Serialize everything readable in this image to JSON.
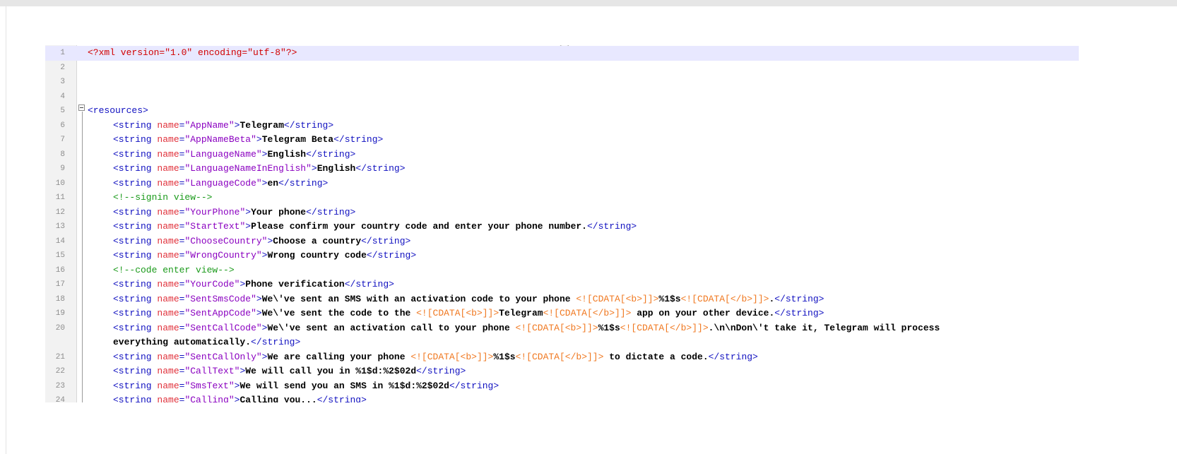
{
  "editor": {
    "lines": [
      {
        "n": "1",
        "segs": [
          [
            "pi",
            "<?xml version=\"1.0\" encoding=\"utf-8\"?>"
          ]
        ]
      },
      {
        "n": "2",
        "segs": []
      },
      {
        "n": "3",
        "segs": []
      },
      {
        "n": "4",
        "segs": []
      },
      {
        "n": "5",
        "segs": [
          [
            "t",
            "<resources>"
          ]
        ]
      },
      {
        "n": "6",
        "segs": [
          [
            "t",
            "<string "
          ],
          [
            "a",
            "name"
          ],
          [
            "t",
            "="
          ],
          [
            "v",
            "\"AppName\""
          ],
          [
            "t",
            ">"
          ],
          [
            "b",
            "Telegram"
          ],
          [
            "t",
            "</string>"
          ]
        ]
      },
      {
        "n": "7",
        "segs": [
          [
            "t",
            "<string "
          ],
          [
            "a",
            "name"
          ],
          [
            "t",
            "="
          ],
          [
            "v",
            "\"AppNameBeta\""
          ],
          [
            "t",
            ">"
          ],
          [
            "b",
            "Telegram Beta"
          ],
          [
            "t",
            "</string>"
          ]
        ]
      },
      {
        "n": "8",
        "segs": [
          [
            "t",
            "<string "
          ],
          [
            "a",
            "name"
          ],
          [
            "t",
            "="
          ],
          [
            "v",
            "\"LanguageName\""
          ],
          [
            "t",
            ">"
          ],
          [
            "b",
            "English"
          ],
          [
            "t",
            "</string>"
          ]
        ]
      },
      {
        "n": "9",
        "segs": [
          [
            "t",
            "<string "
          ],
          [
            "a",
            "name"
          ],
          [
            "t",
            "="
          ],
          [
            "v",
            "\"LanguageNameInEnglish\""
          ],
          [
            "t",
            ">"
          ],
          [
            "b",
            "English"
          ],
          [
            "t",
            "</string>"
          ]
        ]
      },
      {
        "n": "10",
        "segs": [
          [
            "t",
            "<string "
          ],
          [
            "a",
            "name"
          ],
          [
            "t",
            "="
          ],
          [
            "v",
            "\"LanguageCode\""
          ],
          [
            "t",
            ">"
          ],
          [
            "b",
            "en"
          ],
          [
            "t",
            "</string>"
          ]
        ]
      },
      {
        "n": "11",
        "segs": [
          [
            "c",
            "<!--signin view-->"
          ]
        ]
      },
      {
        "n": "12",
        "segs": [
          [
            "t",
            "<string "
          ],
          [
            "a",
            "name"
          ],
          [
            "t",
            "="
          ],
          [
            "v",
            "\"YourPhone\""
          ],
          [
            "t",
            ">"
          ],
          [
            "b",
            "Your phone"
          ],
          [
            "t",
            "</string>"
          ]
        ]
      },
      {
        "n": "13",
        "segs": [
          [
            "t",
            "<string "
          ],
          [
            "a",
            "name"
          ],
          [
            "t",
            "="
          ],
          [
            "v",
            "\"StartText\""
          ],
          [
            "t",
            ">"
          ],
          [
            "b",
            "Please confirm your country code and enter your phone number."
          ],
          [
            "t",
            "</string>"
          ]
        ]
      },
      {
        "n": "14",
        "segs": [
          [
            "t",
            "<string "
          ],
          [
            "a",
            "name"
          ],
          [
            "t",
            "="
          ],
          [
            "v",
            "\"ChooseCountry\""
          ],
          [
            "t",
            ">"
          ],
          [
            "b",
            "Choose a country"
          ],
          [
            "t",
            "</string>"
          ]
        ]
      },
      {
        "n": "15",
        "segs": [
          [
            "t",
            "<string "
          ],
          [
            "a",
            "name"
          ],
          [
            "t",
            "="
          ],
          [
            "v",
            "\"WrongCountry\""
          ],
          [
            "t",
            ">"
          ],
          [
            "b",
            "Wrong country code"
          ],
          [
            "t",
            "</string>"
          ]
        ]
      },
      {
        "n": "16",
        "segs": [
          [
            "c",
            "<!--code enter view-->"
          ]
        ]
      },
      {
        "n": "17",
        "segs": [
          [
            "t",
            "<string "
          ],
          [
            "a",
            "name"
          ],
          [
            "t",
            "="
          ],
          [
            "v",
            "\"YourCode\""
          ],
          [
            "t",
            ">"
          ],
          [
            "b",
            "Phone verification"
          ],
          [
            "t",
            "</string>"
          ]
        ]
      },
      {
        "n": "18",
        "segs": [
          [
            "t",
            "<string "
          ],
          [
            "a",
            "name"
          ],
          [
            "t",
            "="
          ],
          [
            "v",
            "\"SentSmsCode\""
          ],
          [
            "t",
            ">"
          ],
          [
            "b",
            "We\\'ve sent an SMS with an activation code to your phone "
          ],
          [
            "d",
            "<![CDATA[<b>]]>"
          ],
          [
            "b",
            "%1$s"
          ],
          [
            "d",
            "<![CDATA[</b>]]>"
          ],
          [
            "b",
            "."
          ],
          [
            "t",
            "</string>"
          ]
        ]
      },
      {
        "n": "19",
        "segs": [
          [
            "t",
            "<string "
          ],
          [
            "a",
            "name"
          ],
          [
            "t",
            "="
          ],
          [
            "v",
            "\"SentAppCode\""
          ],
          [
            "t",
            ">"
          ],
          [
            "b",
            "We\\'ve sent the code to the "
          ],
          [
            "d",
            "<![CDATA[<b>]]>"
          ],
          [
            "b",
            "Telegram"
          ],
          [
            "d",
            "<![CDATA[</b>]]>"
          ],
          [
            "b",
            " app on your other device."
          ],
          [
            "t",
            "</string>"
          ]
        ]
      },
      {
        "n": "20",
        "segs": [
          [
            "t",
            "<string "
          ],
          [
            "a",
            "name"
          ],
          [
            "t",
            "="
          ],
          [
            "v",
            "\"SentCallCode\""
          ],
          [
            "t",
            ">"
          ],
          [
            "b",
            "We\\'ve sent an activation call to your phone "
          ],
          [
            "d",
            "<![CDATA[<b>]]>"
          ],
          [
            "b",
            "%1$s"
          ],
          [
            "d",
            "<![CDATA[</b>]]>"
          ],
          [
            "b",
            ".\\n\\nDon\\'t take it, Telegram will process"
          ]
        ]
      },
      {
        "n": "",
        "segs": [
          [
            "b",
            "everything automatically."
          ],
          [
            "t",
            "</string>"
          ]
        ],
        "cont": true
      },
      {
        "n": "21",
        "segs": [
          [
            "t",
            "<string "
          ],
          [
            "a",
            "name"
          ],
          [
            "t",
            "="
          ],
          [
            "v",
            "\"SentCallOnly\""
          ],
          [
            "t",
            ">"
          ],
          [
            "b",
            "We are calling your phone "
          ],
          [
            "d",
            "<![CDATA[<b>]]>"
          ],
          [
            "b",
            "%1$s"
          ],
          [
            "d",
            "<![CDATA[</b>]]>"
          ],
          [
            "b",
            " to dictate a code."
          ],
          [
            "t",
            "</string>"
          ]
        ]
      },
      {
        "n": "22",
        "segs": [
          [
            "t",
            "<string "
          ],
          [
            "a",
            "name"
          ],
          [
            "t",
            "="
          ],
          [
            "v",
            "\"CallText\""
          ],
          [
            "t",
            ">"
          ],
          [
            "b",
            "We will call you in %1$d:%2$02d"
          ],
          [
            "t",
            "</string>"
          ]
        ]
      },
      {
        "n": "23",
        "segs": [
          [
            "t",
            "<string "
          ],
          [
            "a",
            "name"
          ],
          [
            "t",
            "="
          ],
          [
            "v",
            "\"SmsText\""
          ],
          [
            "t",
            ">"
          ],
          [
            "b",
            "We will send you an SMS in %1$d:%2$02d"
          ],
          [
            "t",
            "</string>"
          ]
        ]
      },
      {
        "n": "24",
        "segs": [
          [
            "t",
            "<string "
          ],
          [
            "a",
            "name"
          ],
          [
            "t",
            "="
          ],
          [
            "v",
            "\"Calling\""
          ],
          [
            "t",
            ">"
          ],
          [
            "b",
            "Calling you..."
          ],
          [
            "t",
            "</string>"
          ]
        ]
      }
    ]
  }
}
